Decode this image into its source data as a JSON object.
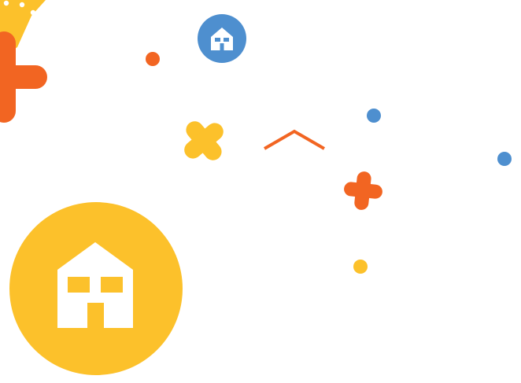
{
  "colors": {
    "background": "#ffffff",
    "yellow": "#fcc12b",
    "orange": "#f26522",
    "blue": "#4e8fcf",
    "white": "#ffffff"
  },
  "icons": {
    "large": "house-icon",
    "small": "house-icon"
  },
  "decorations": [
    "yellow-burst-shape",
    "orange-cross-shape",
    "orange-dot",
    "yellow-cross-shape",
    "orange-chevron-shape",
    "blue-dot",
    "orange-cross-shape",
    "yellow-dot"
  ]
}
